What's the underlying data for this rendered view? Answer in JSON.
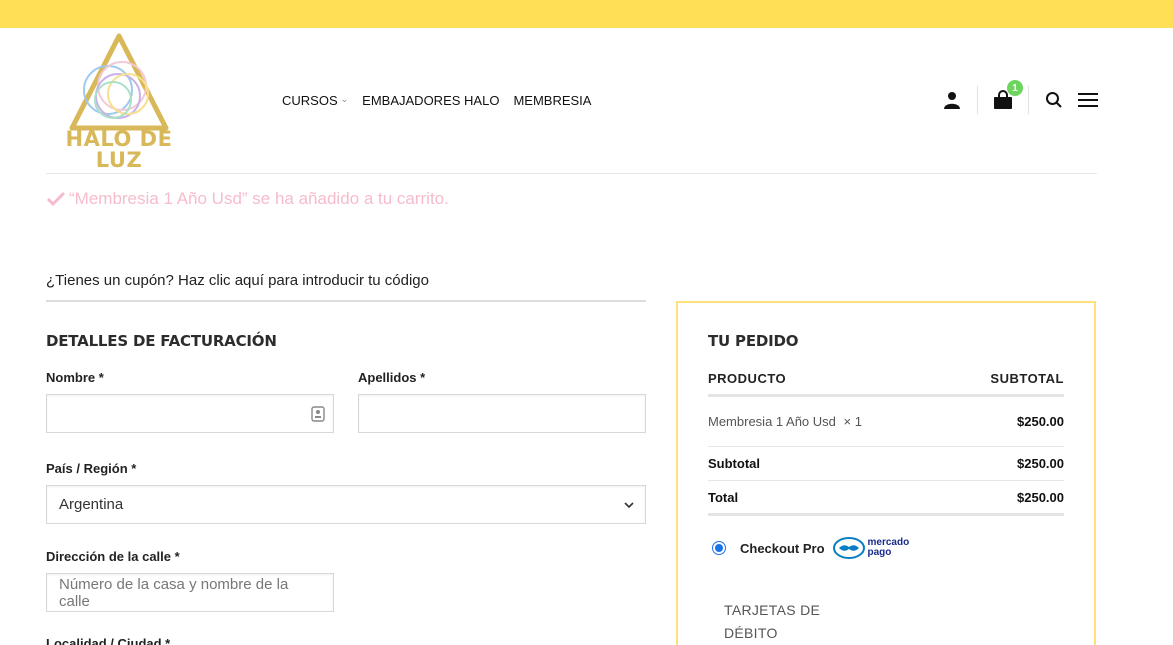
{
  "brand": {
    "logo_line1": "HALO DE",
    "logo_line2": "LUZ"
  },
  "nav": {
    "items": [
      {
        "label": "CURSOS",
        "has_dropdown": true
      },
      {
        "label": "EMBAJADORES HALO"
      },
      {
        "label": "MEMBRESIA"
      }
    ]
  },
  "header_icons": {
    "account": "user-icon",
    "cart": "cart-icon",
    "cart_count": "1",
    "search": "search-icon",
    "menu": "hamburger-icon"
  },
  "notice": {
    "icon": "check-icon",
    "text": "“Membresia 1 Año Usd” se ha añadido a tu carrito."
  },
  "coupon": {
    "text": "¿Tienes un cupón? Haz clic aquí para introducir tu código"
  },
  "billing": {
    "title": "DETALLES DE FACTURACIÓN",
    "first_name_label": "Nombre *",
    "first_name_value": "",
    "last_name_label": "Apellidos *",
    "last_name_value": "",
    "country_label": "País / Región *",
    "country_value": "Argentina",
    "address_label": "Dirección de la calle *",
    "address_placeholder": "Número de la casa y nombre de la calle",
    "city_label": "Localidad / Ciudad *"
  },
  "order": {
    "title": "TU PEDIDO",
    "col_product": "PRODUCTO",
    "col_subtotal": "SUBTOTAL",
    "item_name": "Membresia 1 Año Usd",
    "item_qty": "× 1",
    "item_price": "$250.00",
    "subtotal_label": "Subtotal",
    "subtotal_value": "$250.00",
    "total_label": "Total",
    "total_value": "$250.00"
  },
  "payment": {
    "method_label": "Checkout Pro",
    "logo_line1": "mercado",
    "logo_line2": "pago",
    "cards_line1": "TARJETAS DE",
    "cards_line2": "DÉBITO"
  },
  "colors": {
    "topbar": "#ffdf56",
    "accent_border": "#ffe07a",
    "notice": "#f6bccb",
    "badge": "#6cd45f",
    "logo_gold": "#d8b858"
  }
}
